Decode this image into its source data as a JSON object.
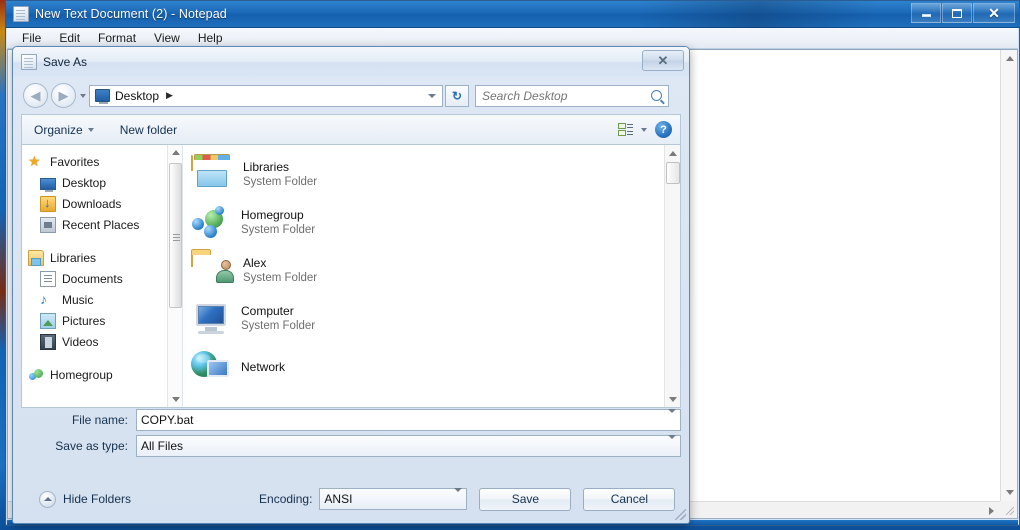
{
  "notepad": {
    "title": "New Text Document (2) - Notepad",
    "icon": "notepad-icon",
    "menus": [
      "File",
      "Edit",
      "Format",
      "View",
      "Help"
    ],
    "window_buttons": {
      "minimize": "minimize-button",
      "maximize": "maximize-button",
      "close_label": "✕"
    },
    "text_content": ""
  },
  "dialog": {
    "title": "Save As",
    "icon": "notepad-icon",
    "close_label": "✕",
    "address": {
      "icon": "computer-icon",
      "path": "Desktop",
      "chevron": "▶",
      "refresh_label": "↻"
    },
    "search": {
      "placeholder": "Search Desktop",
      "value": "",
      "icon": "search-icon"
    },
    "toolbar": {
      "organize_label": "Organize",
      "new_folder_label": "New folder",
      "view_icon": "view-mode-icon",
      "help_label": "?"
    },
    "nav_pane": {
      "groups": [
        {
          "root": {
            "label": "Favorites",
            "icon": "star-icon"
          },
          "items": [
            {
              "label": "Desktop",
              "icon": "desktop-icon"
            },
            {
              "label": "Downloads",
              "icon": "downloads-icon"
            },
            {
              "label": "Recent Places",
              "icon": "recent-places-icon"
            }
          ]
        },
        {
          "root": {
            "label": "Libraries",
            "icon": "libraries-icon"
          },
          "items": [
            {
              "label": "Documents",
              "icon": "documents-icon"
            },
            {
              "label": "Music",
              "icon": "music-icon"
            },
            {
              "label": "Pictures",
              "icon": "pictures-icon"
            },
            {
              "label": "Videos",
              "icon": "videos-icon"
            }
          ]
        },
        {
          "root": {
            "label": "Homegroup",
            "icon": "homegroup-icon"
          },
          "items": []
        }
      ]
    },
    "file_list": [
      {
        "name": "Libraries",
        "type": "System Folder",
        "icon": "libraries-folder-icon"
      },
      {
        "name": "Homegroup",
        "type": "System Folder",
        "icon": "homegroup-icon"
      },
      {
        "name": "Alex",
        "type": "System Folder",
        "icon": "user-folder-icon"
      },
      {
        "name": "Computer",
        "type": "System Folder",
        "icon": "computer-icon"
      },
      {
        "name": "Network",
        "type": "",
        "icon": "network-icon"
      }
    ],
    "fields": {
      "file_name_label": "File name:",
      "file_name_value": "COPY.bat",
      "save_as_type_label": "Save as type:",
      "save_as_type_value": "All Files"
    },
    "footer": {
      "hide_folders_label": "Hide Folders",
      "encoding_label": "Encoding:",
      "encoding_value": "ANSI",
      "save_label": "Save",
      "cancel_label": "Cancel"
    }
  },
  "colors": {
    "titlebar_blue": "#1b69b8",
    "dialog_bg": "#dee8f4",
    "accent": "#2a74c0",
    "text": "#16314e"
  }
}
